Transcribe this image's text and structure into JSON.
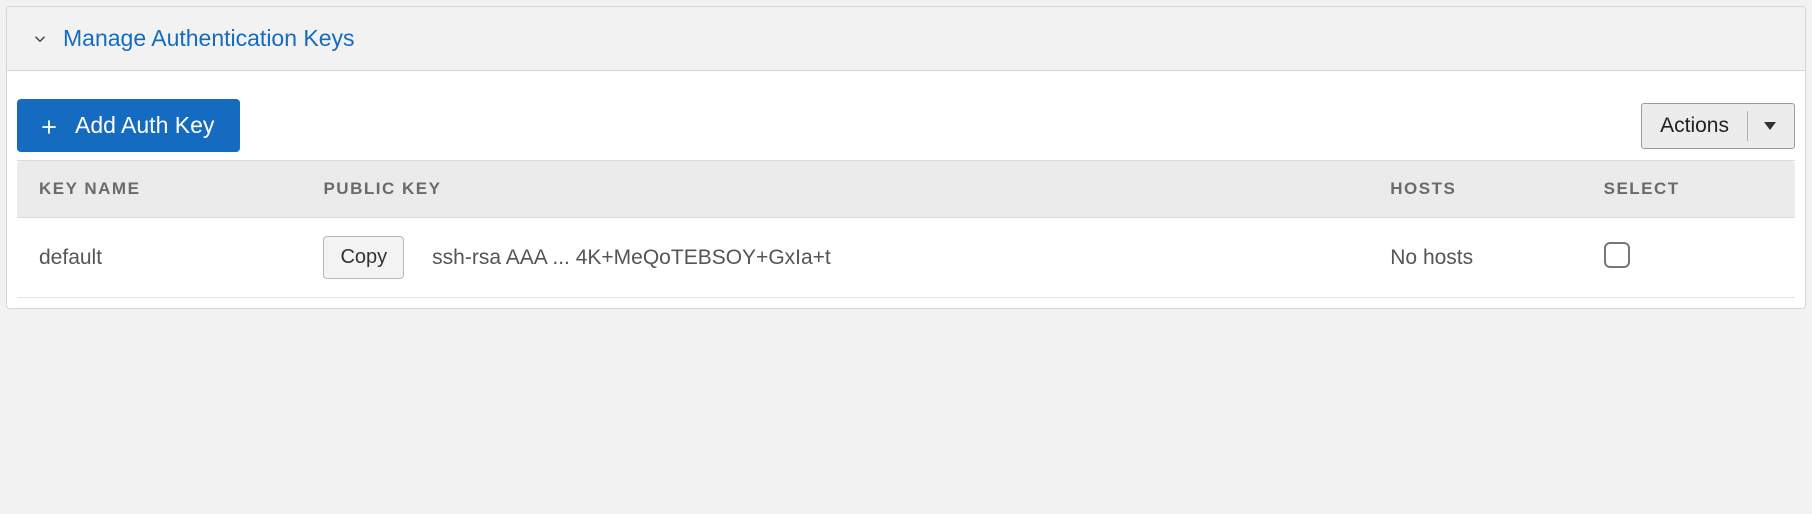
{
  "panel": {
    "title": "Manage Authentication Keys"
  },
  "toolbar": {
    "add_button_label": "Add Auth Key",
    "actions_label": "Actions"
  },
  "table": {
    "columns": {
      "key_name": "Key Name",
      "public_key": "Public Key",
      "hosts": "Hosts",
      "select": "Select"
    },
    "rows": [
      {
        "key_name": "default",
        "copy_label": "Copy",
        "public_key_text": "ssh-rsa AAA ... 4K+MeQoTEBSOY+GxIa+t",
        "hosts": "No hosts",
        "selected": false
      }
    ]
  }
}
